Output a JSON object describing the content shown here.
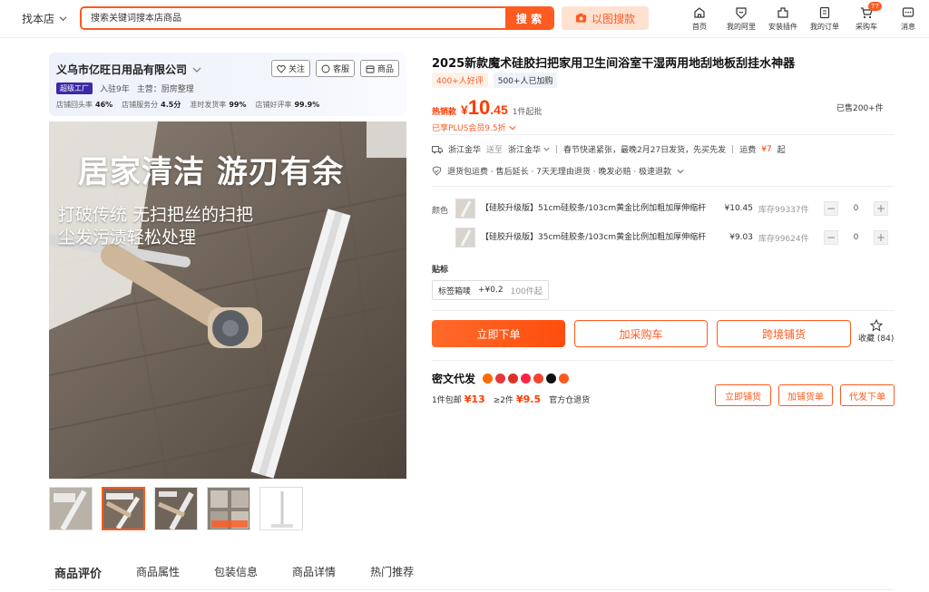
{
  "header": {
    "scope_label": "找本店",
    "search_placeholder": "搜索关键词搜本店商品",
    "search_button": "搜 索",
    "image_search": "以图搜款",
    "nav": [
      {
        "icon": "home-icon",
        "label": "首页"
      },
      {
        "icon": "heart-shield-icon",
        "label": "我的阿里"
      },
      {
        "icon": "plugin-icon",
        "label": "安装插件"
      },
      {
        "icon": "order-icon",
        "label": "我的订单"
      },
      {
        "icon": "cart-icon",
        "label": "采购车",
        "badge": "77"
      },
      {
        "icon": "message-icon",
        "label": "消息"
      }
    ]
  },
  "shop": {
    "name": "义乌市亿旺日用品有限公司",
    "follow": "关注",
    "service": "客服",
    "goods": "商品",
    "factory_badge": "超级工厂",
    "years": "入驻9年",
    "main_business": "主营：厨房整理",
    "stats": [
      {
        "label": "店铺回头率",
        "value": "46%"
      },
      {
        "label": "店铺服务分",
        "value": "4.5分"
      },
      {
        "label": "准时发货率",
        "value": "99%"
      },
      {
        "label": "店铺好评率",
        "value": "99.9%"
      }
    ]
  },
  "main_image": {
    "headline": "居家清洁 游刃有余",
    "line1": "打破传统 无扫把丝的扫把",
    "line2": "尘发污渍轻松处理"
  },
  "tabs": [
    "商品评价",
    "商品属性",
    "包装信息",
    "商品详情",
    "热门推荐"
  ],
  "product": {
    "title": "2025新款魔术硅胶扫把家用卫生间浴室干湿两用地刮地板刮挂水神器",
    "tag_good_reviews": "400+人好评",
    "tag_added": "500+人已加购",
    "hot_label": "热销款",
    "price_symbol": "¥",
    "price_int": "10",
    "price_dec": ".45",
    "moq": "1件起批",
    "sold": "已售200+件",
    "plus": "已享PLUS会员9.5折",
    "ship_from": "浙江金华",
    "ship_to_label": "送至",
    "ship_to": "浙江金华",
    "ship_note": "春节快递紧张，最晚2月27日发货，先买先发",
    "freight_label": "运费",
    "freight": "¥7",
    "freight_suffix": "起",
    "services": "退货包运费 · 售后延长 · 7天无理由退货 · 晚发必赔 · 极速退款",
    "color_label": "颜色",
    "skus": [
      {
        "name": "【硅胶升级版】51cm硅胶条/103cm黄金比例加粗加厚伸缩杆",
        "price": "¥10.45",
        "stock": "库存99337件",
        "qty": "0"
      },
      {
        "name": "【硅胶升级版】35cm硅胶条/103cm黄金比例加粗加厚伸缩杆",
        "price": "¥9.03",
        "stock": "库存99624件",
        "qty": "0"
      }
    ],
    "tie_label": "贴标",
    "tie_option": "标签箱唛",
    "tie_price": "+¥0.2",
    "tie_moq": "100件起",
    "btn_order": "立即下单",
    "btn_cart": "加采购车",
    "btn_cross": "跨境铺货",
    "fav_label": "收藏",
    "fav_count": "(84)"
  },
  "dropship": {
    "title": "密文代发",
    "one": "1件包邮",
    "one_price": "¥13",
    "two": "≥2件",
    "two_price": "¥9.5",
    "note": "官方仓退货",
    "btn1": "立即铺货",
    "btn2": "加铺货单",
    "btn3": "代发下单"
  }
}
